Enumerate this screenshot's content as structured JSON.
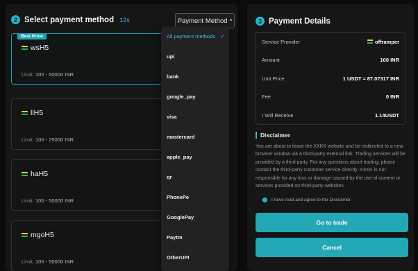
{
  "left": {
    "step": "2",
    "title": "Select payment method",
    "timer": "12s",
    "method_button": "Payment Method",
    "cards": [
      {
        "badge": "Best Price",
        "name": "wsH5",
        "limit_label": "Limit:",
        "limit": "100 - 50000 INR"
      },
      {
        "name": "llH5",
        "limit_label": "Limit:",
        "limit": "100 - 25000 INR"
      },
      {
        "name": "haH5",
        "limit_label": "Limit:",
        "limit": "100 - 50000 INR"
      },
      {
        "name": "mgoH5",
        "limit_label": "Limit:",
        "limit": "100 - 50000 INR"
      }
    ]
  },
  "dropdown": {
    "items": [
      "All payment methods",
      "upi",
      "bank",
      "google_pay",
      "visa",
      "mastercard",
      "apple_pay",
      "qr",
      "PhonePe",
      "GooglePay",
      "Paytm",
      "OtherUPI"
    ],
    "selected_index": 0
  },
  "right": {
    "step": "3",
    "title": "Payment Details",
    "rows": [
      {
        "k": "Service Provider",
        "v": "offramper"
      },
      {
        "k": "Amount",
        "v": "100 INR"
      },
      {
        "k": "Unit Price",
        "v": "1 USDT ≈ 87.07317 INR"
      },
      {
        "k": "Fee",
        "v": "0 INR"
      },
      {
        "k": "I Will Receive",
        "v": "1.14USDT"
      }
    ],
    "disclaimer_title": "Disclaimer",
    "disclaimer_text": "You are about to leave the XXKK website and be redirected to a new browser window via a third-party external link. Trading services will be provided by a third party. For any questions about trading, please contact the third-party customer service directly. XXKK is not responsible for any loss or damage caused by the use of content or services provided on third-party websites.",
    "agree_text": "I have read and agree to the Disclaimer",
    "trade_button": "Go to trade",
    "cancel_button": "Cancel"
  },
  "colors": {
    "accent": "#23a8b5",
    "accent_text": "#27c2d2",
    "background": "#0b0b0b",
    "panel": "#161616"
  }
}
